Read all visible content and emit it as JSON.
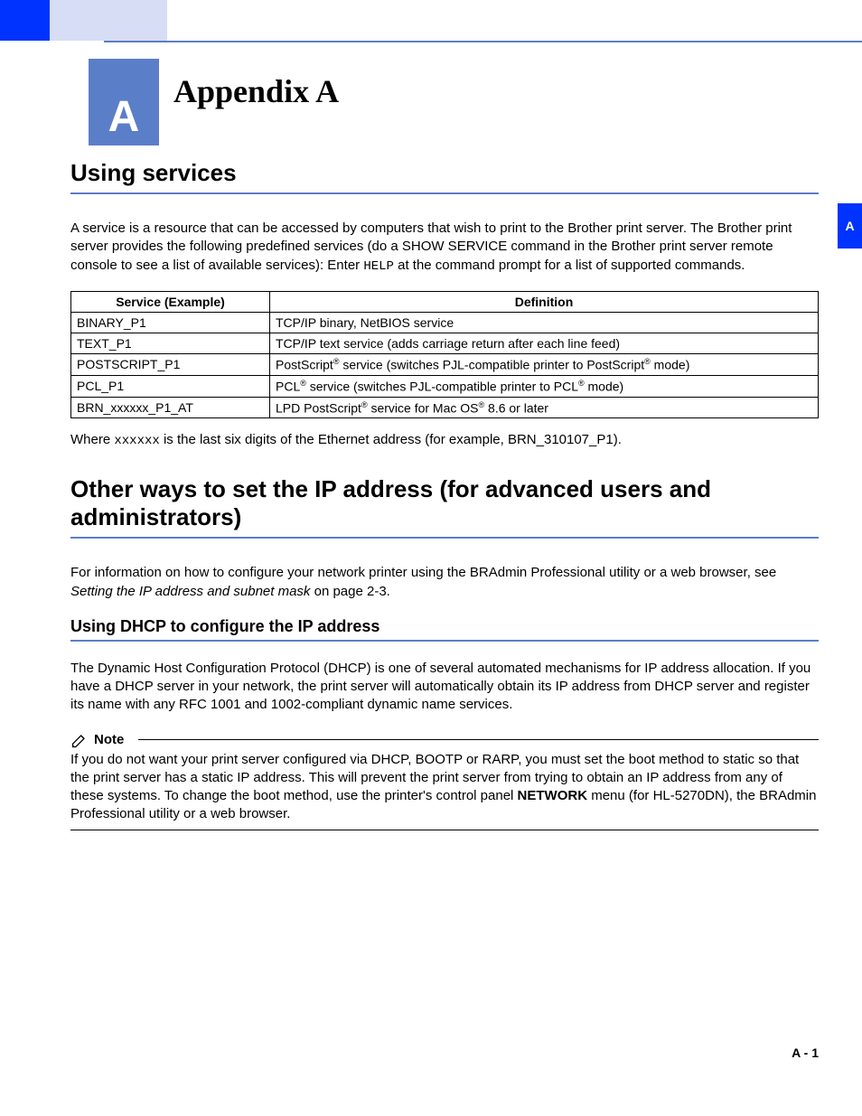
{
  "header": {
    "badge_letter": "A",
    "title": "Appendix A",
    "side_tab": "A"
  },
  "section1": {
    "heading": "Using services",
    "para1_a": "A service is a resource that can be accessed by computers that wish to print to the Brother print server. The Brother print server provides the following predefined services (do a SHOW SERVICE command in the Brother print server remote console to see a list of available services): Enter ",
    "para1_code": "HELP",
    "para1_b": " at the command prompt for a list of supported commands.",
    "table": {
      "col1": "Service (Example)",
      "col2": "Definition",
      "rows": [
        {
          "s": "BINARY_P1",
          "d": "TCP/IP binary, NetBIOS service"
        },
        {
          "s": "TEXT_P1",
          "d": "TCP/IP text service (adds carriage return after each line feed)"
        },
        {
          "s": "POSTSCRIPT_P1",
          "d_parts": [
            "PostScript",
            "®",
            " service (switches PJL-compatible printer to PostScript",
            "®",
            " mode)"
          ]
        },
        {
          "s": "PCL_P1",
          "d_parts": [
            "PCL",
            "®",
            " service (switches PJL-compatible printer to PCL",
            "®",
            " mode)"
          ]
        },
        {
          "s": "BRN_xxxxxx_P1_AT",
          "d_parts": [
            "LPD PostScript",
            "®",
            " service for Mac OS",
            "®",
            " 8.6 or later"
          ]
        }
      ]
    },
    "para2_a": "Where ",
    "para2_code": "xxxxxx",
    "para2_b": " is the last six digits of the Ethernet address (for example, BRN_310107_P1).",
    "reg": "®"
  },
  "section2": {
    "heading": "Other ways to set the IP address (for advanced users and administrators)",
    "para_a": "For information on how to configure your network printer using the BRAdmin Professional utility or a web browser, see ",
    "para_italic": "Setting the IP address and subnet mask",
    "para_b": " on page 2-3."
  },
  "section3": {
    "heading": "Using DHCP to configure the IP address",
    "para": "The Dynamic Host Configuration Protocol (DHCP) is one of several automated mechanisms for IP address allocation. If you have a DHCP server in your network, the print server will automatically obtain its IP address from DHCP server and register its name with any RFC 1001 and 1002-compliant dynamic name services."
  },
  "note": {
    "label": "Note",
    "body_a": "If you do not want your print server configured via DHCP, BOOTP or RARP, you must set the boot method to static so that the print server has a static IP address. This will prevent the print server from trying to obtain an IP address from any of these systems. To change the boot method, use the printer's control panel ",
    "body_bold": "NETWORK",
    "body_b": " menu (for HL-5270DN), the BRAdmin Professional utility or a web browser."
  },
  "page_number": "A - 1"
}
